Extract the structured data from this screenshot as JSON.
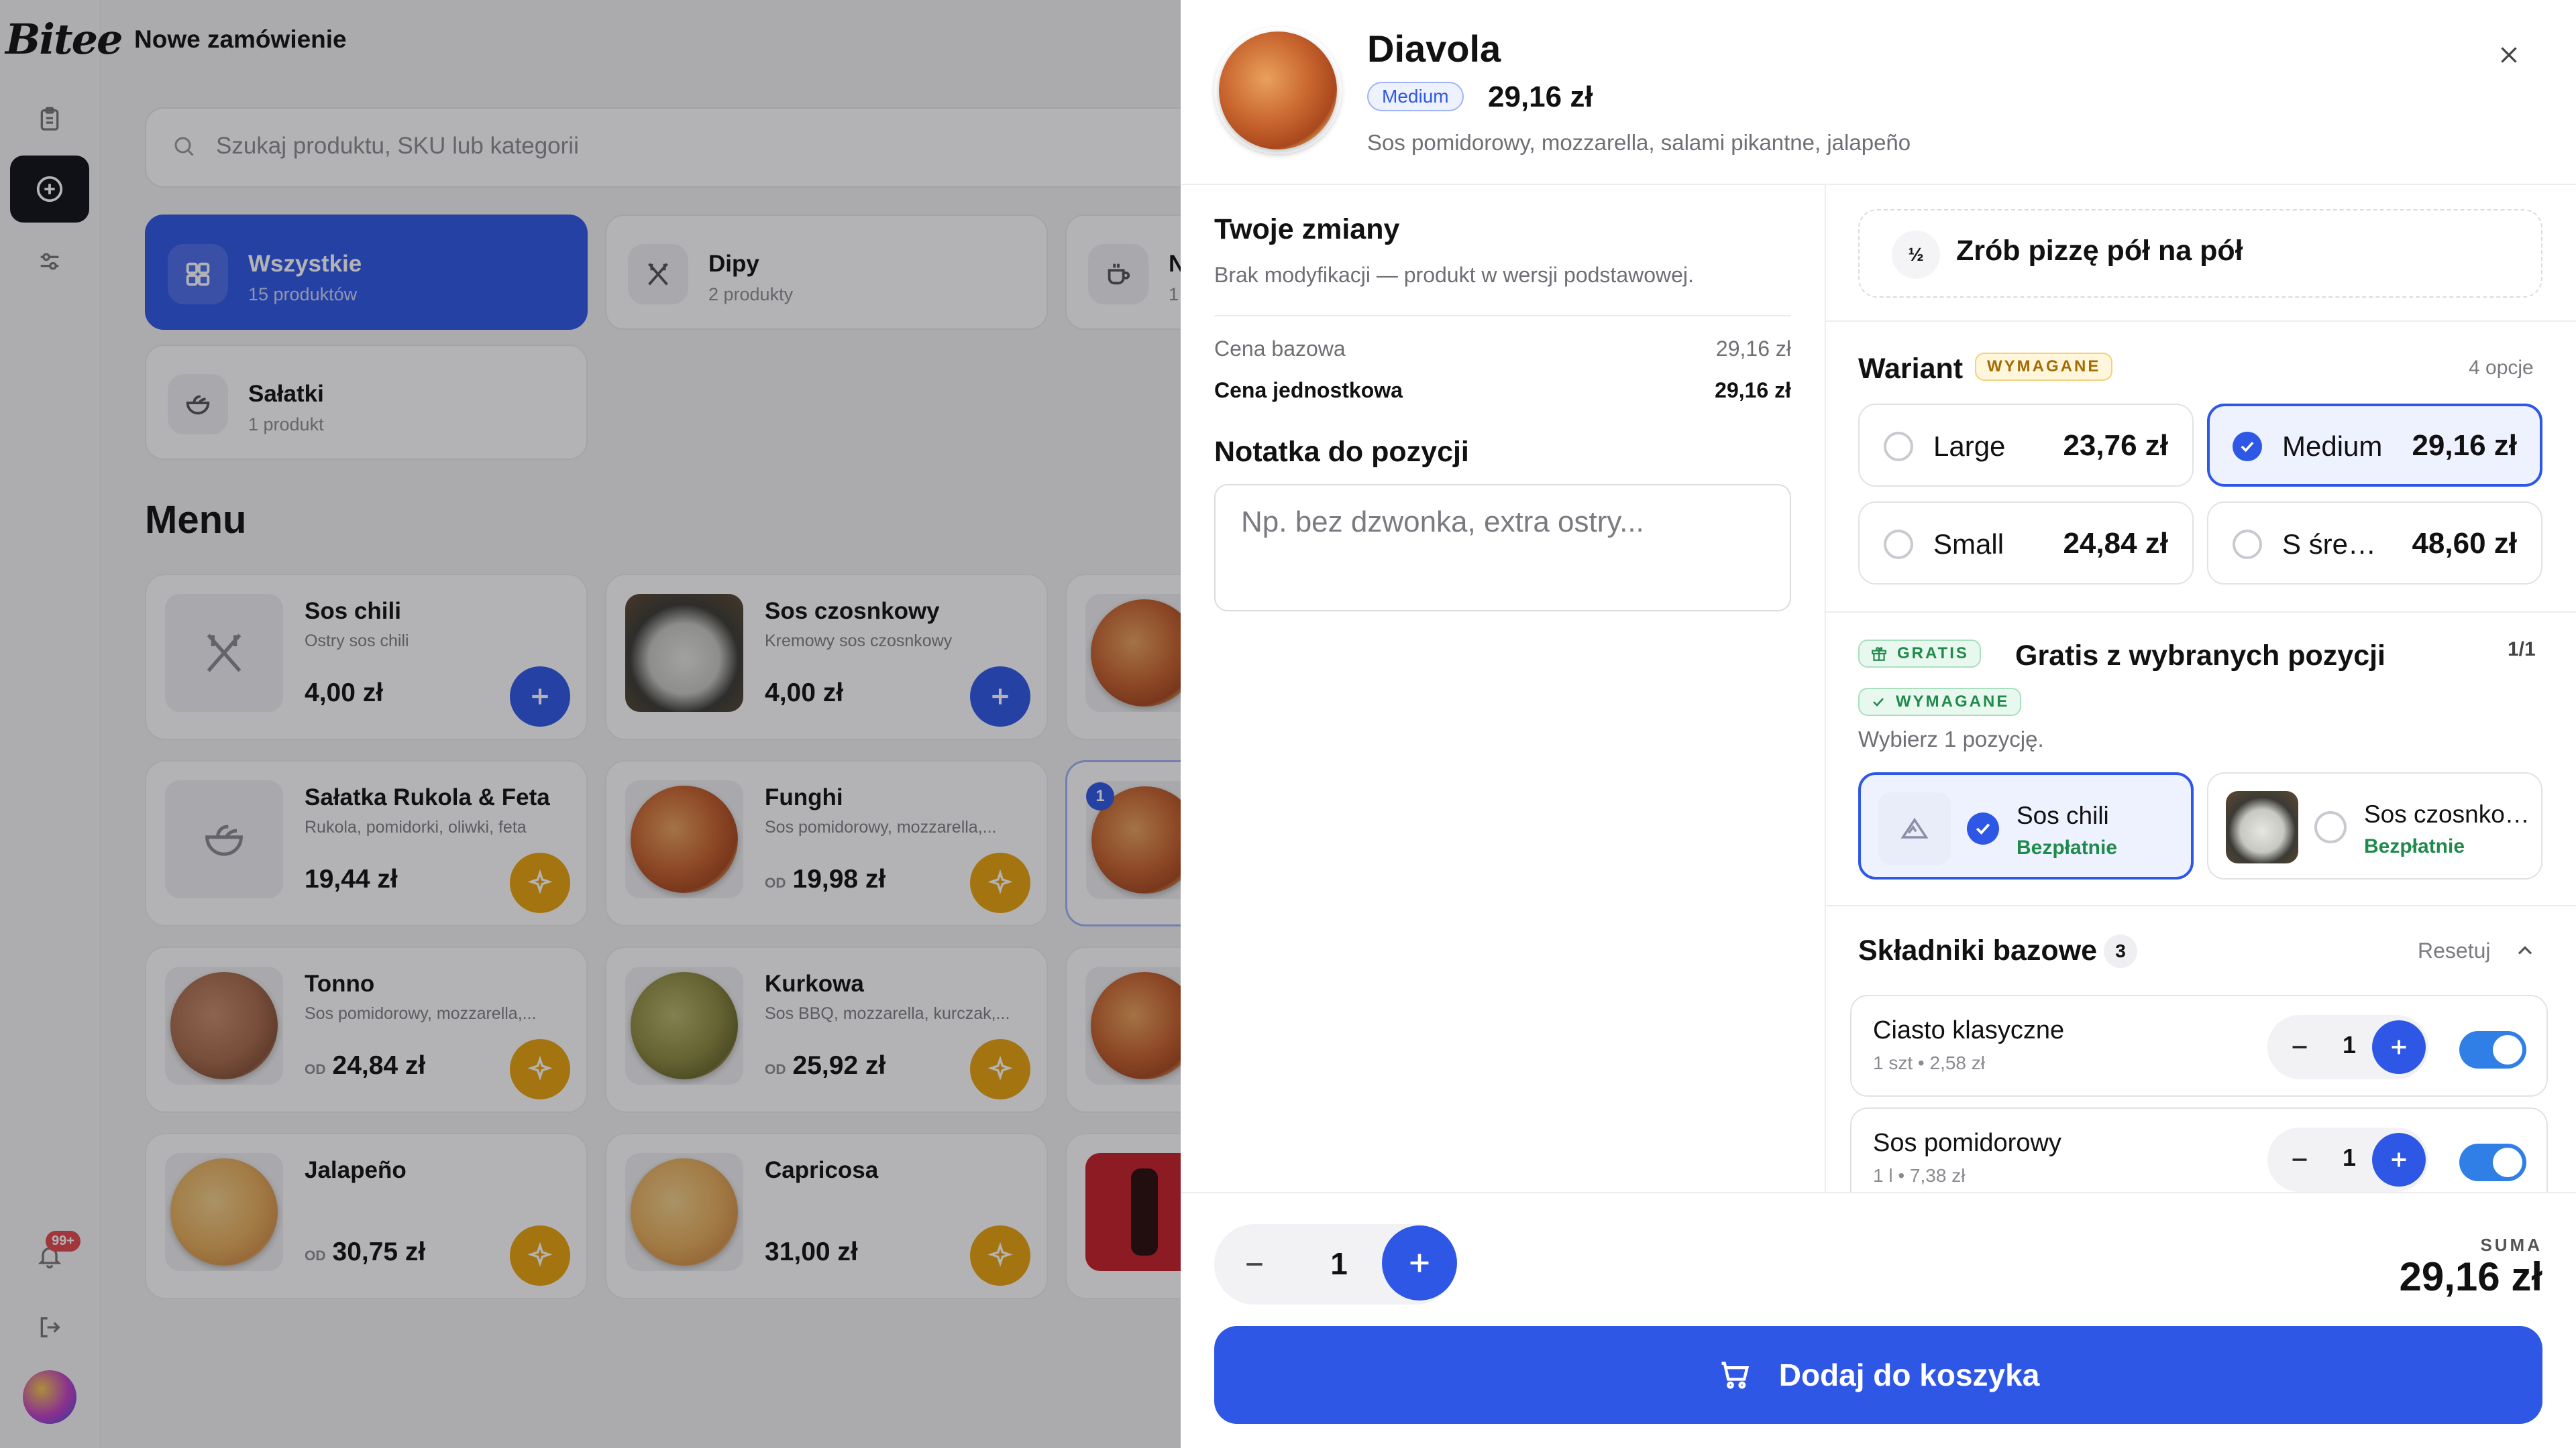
{
  "app": {
    "logo": "Bitee",
    "page_title": "Nowe zamówienie",
    "notifications_badge": "99+"
  },
  "search": {
    "placeholder": "Szukaj produktu, SKU lub kategorii"
  },
  "categories": [
    {
      "name": "Wszystkie",
      "count": "15 produktów",
      "icon": "grid-icon",
      "active": true
    },
    {
      "name": "Dipy",
      "count": "2 produkty",
      "icon": "utensils-off-icon"
    },
    {
      "name": "N",
      "count": "1",
      "icon": "cup-icon"
    },
    {
      "name": "Sałatki",
      "count": "1 produkt",
      "icon": "salad-bowl-icon"
    }
  ],
  "menu": {
    "heading": "Menu",
    "products": [
      {
        "name": "Sos chili",
        "desc": "Ostry sos chili",
        "price": "4,00 zł",
        "from": "",
        "action": "add"
      },
      {
        "name": "Sos czosnkowy",
        "desc": "Kremowy sos czosnkowy",
        "price": "4,00 zł",
        "from": "",
        "action": "add"
      },
      {
        "name": "Sałatka Rukola & Feta",
        "desc": "Rukola, pomidorki, oliwki, feta",
        "price": "19,44 zł",
        "from": "",
        "action": "configure"
      },
      {
        "name": "Funghi",
        "desc": "Sos pomidorowy, mozzarella,...",
        "price": "19,98 zł",
        "from": "OD",
        "action": "configure"
      },
      {
        "name": "Tonno",
        "desc": "Sos pomidorowy, mozzarella,...",
        "price": "24,84 zł",
        "from": "OD",
        "action": "configure"
      },
      {
        "name": "Kurkowa",
        "desc": "Sos BBQ, mozzarella, kurczak,...",
        "price": "25,92 zł",
        "from": "OD",
        "action": "configure"
      },
      {
        "name": "Jalapeño",
        "desc": "",
        "price": "30,75 zł",
        "from": "OD",
        "action": "configure"
      },
      {
        "name": "Capricosa",
        "desc": "",
        "price": "31,00 zł",
        "from": "",
        "action": "configure"
      }
    ],
    "cart_badge": "1"
  },
  "drawer": {
    "title": "Diavola",
    "size_badge": "Medium",
    "price": "29,16 zł",
    "description": "Sos pomidorowy, mozzarella, salami pikantne, jalapeño",
    "changes": {
      "title": "Twoje zmiany",
      "subtitle": "Brak modyfikacji — produkt w wersji podstawowej.",
      "base_price_label": "Cena bazowa",
      "base_price": "29,16 zł",
      "unit_price_label": "Cena jednostkowa",
      "unit_price": "29,16 zł"
    },
    "note": {
      "title": "Notatka do pozycji",
      "placeholder": "Np. bez dzwonka, extra ostry..."
    },
    "half_half": {
      "icon_text": "½",
      "label": "Zrób pizzę pół na pół"
    },
    "variant": {
      "title": "Wariant",
      "required": "WYMAGANE",
      "count": "4 opcje",
      "options": [
        {
          "name": "Large",
          "price": "23,76 zł",
          "selected": false
        },
        {
          "name": "Medium",
          "price": "29,16 zł",
          "selected": true
        },
        {
          "name": "Small",
          "price": "24,84 zł",
          "selected": false
        },
        {
          "name": "S średnia",
          "price": "48,60 zł",
          "selected": false
        }
      ]
    },
    "gratis": {
      "badge": "GRATIS",
      "title": "Gratis z wybranych pozycji",
      "count": "1/1",
      "required": "WYMAGANE",
      "hint": "Wybierz 1 pozycję.",
      "options": [
        {
          "name": "Sos chili",
          "sub": "Bezpłatnie",
          "selected": true
        },
        {
          "name": "Sos czosnkowy",
          "sub": "Bezpłatnie",
          "selected": false
        }
      ]
    },
    "base_ingredients": {
      "title": "Składniki bazowe",
      "count": "3",
      "reset": "Resetuj",
      "items": [
        {
          "name": "Ciasto klasyczne",
          "sub": "1 szt • 2,58 zł",
          "qty": "1",
          "enabled": true
        },
        {
          "name": "Sos pomidorowy",
          "sub": "1 l • 7,38 zł",
          "qty": "1",
          "enabled": true
        }
      ]
    },
    "footer": {
      "qty": "1",
      "sum_label": "SUMA",
      "sum_value": "29,16 zł",
      "add_button": "Dodaj do koszyka"
    }
  },
  "colors": {
    "accent": "#2f57e6",
    "configure": "#e9a20d",
    "gratis": "#1f8a4c",
    "required": "#a36b00"
  }
}
